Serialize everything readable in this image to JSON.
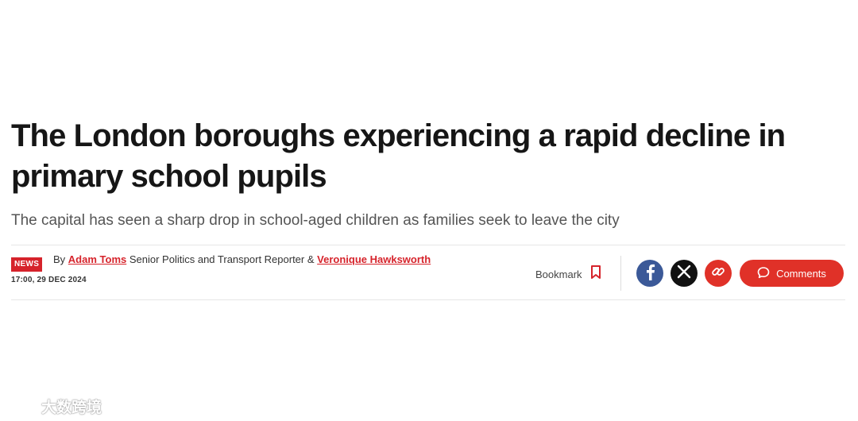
{
  "article": {
    "headline": "The London boroughs experiencing a rapid decline in primary school pupils",
    "standfirst": "The capital has seen a sharp drop in school-aged children as families seek to leave the city"
  },
  "byline": {
    "badge": "NEWS",
    "prefix": "By",
    "author1": "Adam Toms",
    "author1_role": "Senior Politics and Transport Reporter &",
    "author2": "Veronique Hawksworth",
    "timestamp": "17:00, 29 DEC 2024"
  },
  "actions": {
    "bookmark_label": "Bookmark",
    "comments_label": "Comments"
  },
  "watermark": {
    "text": "大数跨境"
  },
  "icons": {
    "bookmark": "bookmark-icon",
    "facebook": "facebook-icon",
    "x": "x-icon",
    "link": "link-icon",
    "comment": "comment-bubble-icon"
  },
  "colors": {
    "accent": "#e03128",
    "author_link": "#d6232b",
    "facebook": "#3b5998",
    "x": "#111111"
  }
}
